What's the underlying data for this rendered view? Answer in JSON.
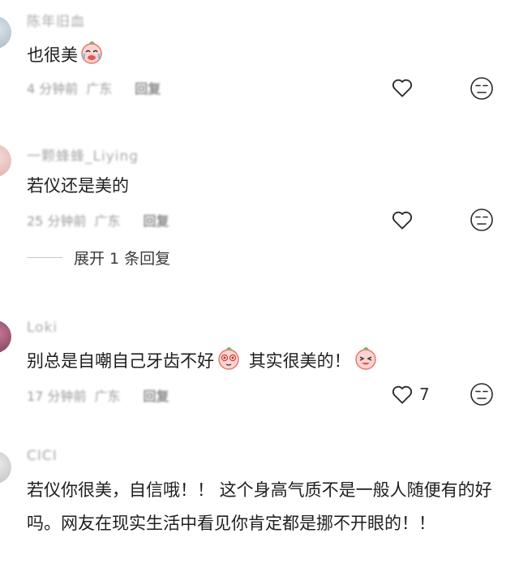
{
  "comments": [
    {
      "username": "陈年旧血",
      "text": "也很美",
      "time": "4 分钟前",
      "location": "广东",
      "reply_label": "回复"
    },
    {
      "username": "一颗蜂蜂_Liying",
      "text": "若仪还是美的",
      "time": "25 分钟前",
      "location": "广东",
      "reply_label": "回复",
      "expand_label": "展开 1 条回复"
    },
    {
      "username": "Loki",
      "text_part1": "别总是自嘲自己牙齿不好",
      "text_part2": "其实很美的！",
      "time": "17 分钟前",
      "location": "广东",
      "reply_label": "回复",
      "likes": "7"
    },
    {
      "username": "CICI",
      "text": "若仪你很美，自信哦！！ 这个身高气质不是一般人随便有的好吗。网友在现实生活中看见你肯定都是挪不开眼的！！"
    }
  ],
  "icons": {
    "like": "heart-outline-icon",
    "dislike": "neutral-face-icon",
    "emoji": "crying-laugh-emoji"
  },
  "colors": {
    "text": "#1e1e1e",
    "meta": "#9a9a9a",
    "icon_stroke": "#2a2a2a"
  }
}
